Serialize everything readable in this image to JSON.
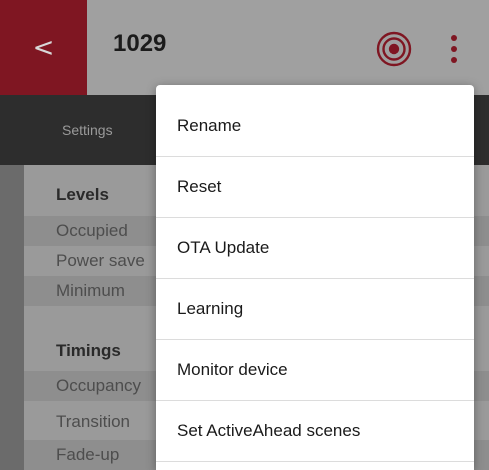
{
  "header": {
    "back_glyph": "<",
    "device_name": "1029",
    "target_icon": "target-icon",
    "more_icon": "more-vertical-icon",
    "accent_color": "#7f1622"
  },
  "tabs": {
    "settings_label": "Settings"
  },
  "settings": {
    "levels_heading": "Levels",
    "levels_rows": [
      "Occupied",
      "Power save",
      "Minimum"
    ],
    "timings_heading": "Timings",
    "timings_rows": [
      "Occupancy",
      "Transition",
      "Fade-up"
    ]
  },
  "menu": {
    "items": [
      "Rename",
      "Reset",
      "OTA Update",
      "Learning",
      "Monitor device",
      "Set ActiveAhead scenes"
    ]
  }
}
